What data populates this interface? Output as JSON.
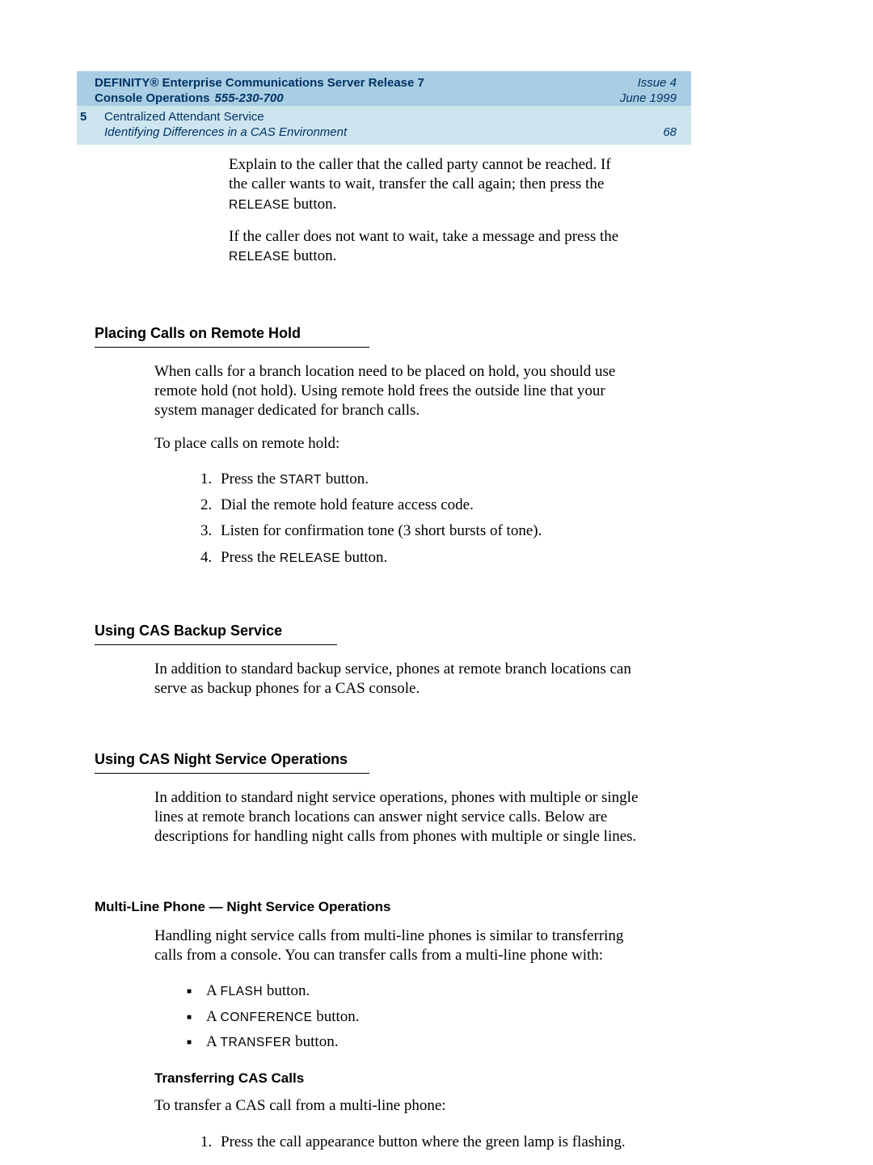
{
  "header": {
    "line1_a": "DEFINITY® Enterprise Communications Server Release 7",
    "line2_a": "Console Operations",
    "docnum": "555-230-700",
    "issue": "Issue 4",
    "date": "June 1999"
  },
  "subheader": {
    "chapnum": "5",
    "chapter_title": "Centralized Attendant Service",
    "section_title": "Identifying Differences in a CAS Environment",
    "page": "68"
  },
  "intro": {
    "p1_a": "Explain to the caller that the called party cannot be reached. If the caller wants to wait, transfer the call again; then press the ",
    "p1_btn": "RELEASE",
    "p1_b": " button.",
    "p2_a": "If the caller does not want to wait, take a message and press the ",
    "p2_btn": "RELEASE",
    "p2_b": " button."
  },
  "s_remote_hold": {
    "title": "Placing Calls on Remote Hold",
    "p1": "When calls for a branch location need to be placed on hold, you should use remote hold (not hold). Using remote hold frees the outside line that your system manager dedicated for branch calls.",
    "p2": "To place calls on remote hold:",
    "steps": {
      "s1_a": "Press the ",
      "s1_btn": "START",
      "s1_b": " button.",
      "s2": "Dial the remote hold feature access code.",
      "s3": "Listen for confirmation tone (3 short bursts of tone).",
      "s4_a": "Press the ",
      "s4_btn": "RELEASE",
      "s4_b": " button."
    }
  },
  "s_backup": {
    "title": "Using CAS Backup Service",
    "p1": "In addition to standard backup service, phones at remote branch locations can serve as backup phones for a CAS console."
  },
  "s_night": {
    "title": "Using CAS Night Service Operations",
    "p1": "In addition to standard night service operations, phones with multiple or single lines at remote branch locations can answer night service calls. Below are descriptions for handling night calls from phones with multiple or single lines."
  },
  "s_multiline": {
    "title": "Multi-Line Phone — Night Service Operations",
    "p1": "Handling night service calls from multi-line phones is similar to transferring calls from a console. You can transfer calls from a multi-line phone with:",
    "bullets": {
      "b1_a": "A ",
      "b1_btn": "FLASH",
      "b1_b": " button.",
      "b2_a": "A ",
      "b2_btn": "CONFERENCE",
      "b2_b": " button.",
      "b3_a": "A ",
      "b3_btn": "TRANSFER",
      "b3_b": " button."
    },
    "sub_title": "Transferring CAS Calls",
    "p2": "To transfer a CAS call from a multi-line phone:",
    "steps": {
      "s1": "Press the call appearance button where the green lamp is flashing."
    }
  }
}
